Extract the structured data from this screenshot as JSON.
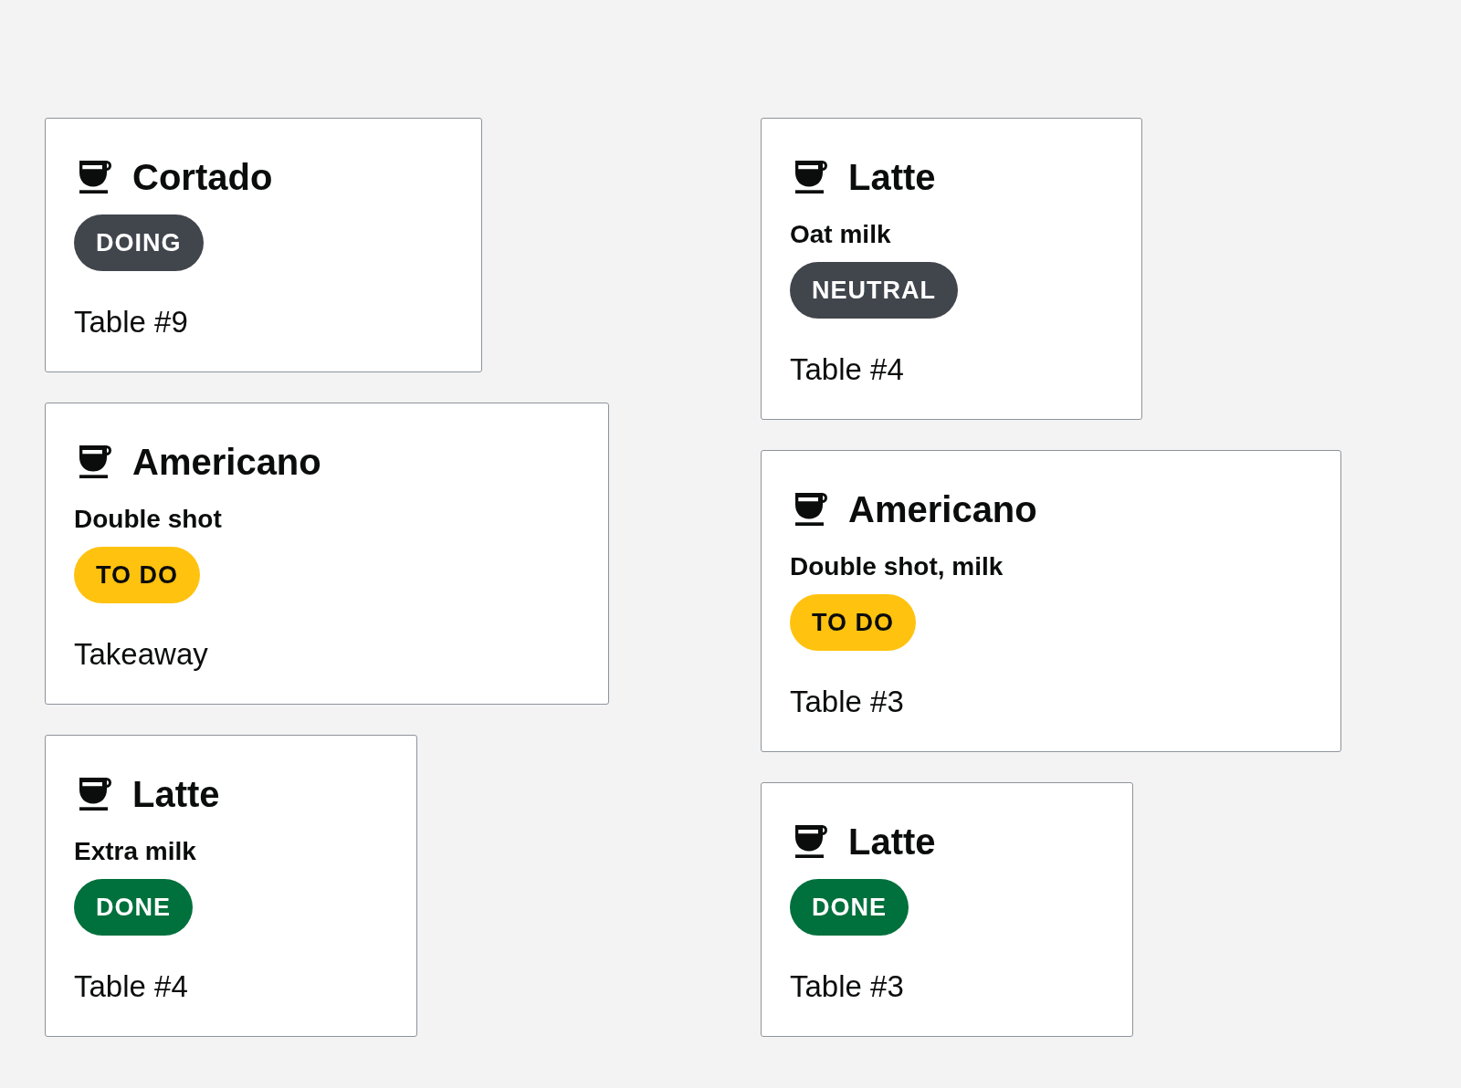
{
  "columns": [
    {
      "orders": [
        {
          "drink": "Cortado",
          "status": {
            "label": "DOING",
            "color": "#41454c"
          },
          "location": "Table #9"
        },
        {
          "drink": "Americano",
          "note": "Double shot",
          "status": {
            "label": "TO DO",
            "color": "#ffc20e"
          },
          "location": "Takeaway"
        },
        {
          "drink": "Latte",
          "note": "Extra milk",
          "status": {
            "label": "DONE",
            "color": "#00703c"
          },
          "location": "Table #4"
        }
      ]
    },
    {
      "orders": [
        {
          "drink": "Latte",
          "note": "Oat milk",
          "status": {
            "label": "NEUTRAL",
            "color": "#41454c"
          },
          "location": "Table #4"
        },
        {
          "drink": "Americano",
          "note": "Double shot, milk",
          "status": {
            "label": "TO DO",
            "color": "#ffc20e"
          },
          "location": "Table #3"
        },
        {
          "drink": "Latte",
          "status": {
            "label": "DONE",
            "color": "#00703c"
          },
          "location": "Table #3"
        }
      ]
    }
  ]
}
